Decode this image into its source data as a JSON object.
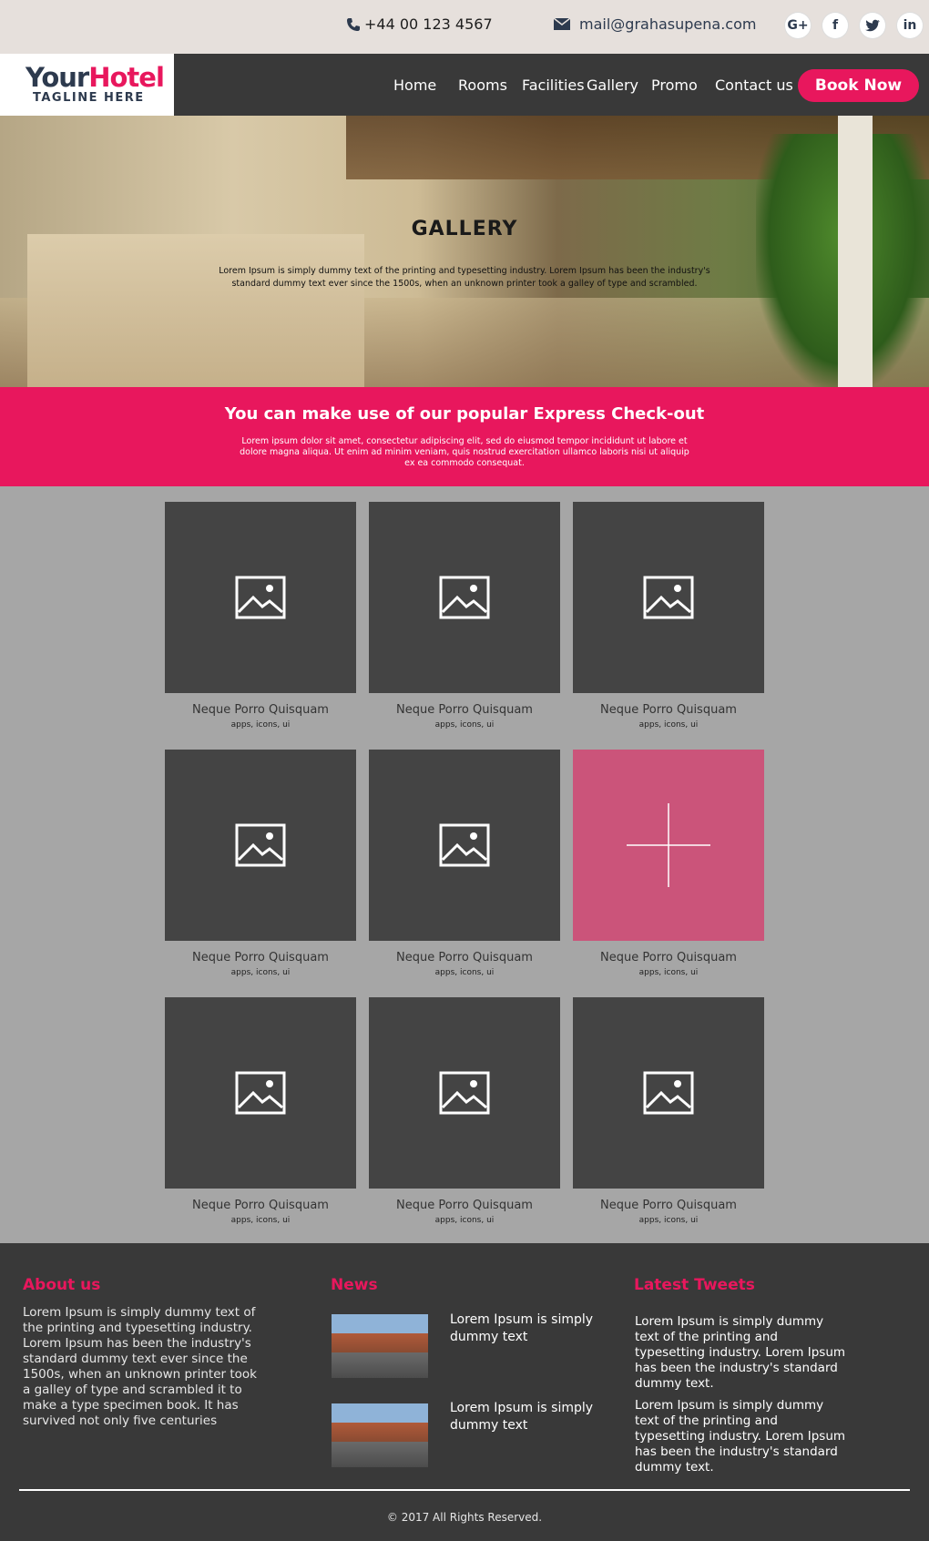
{
  "topbar": {
    "phone": "+44 00 123 4567",
    "email": "mail@grahasupena.com",
    "socials": [
      {
        "name": "google-plus",
        "glyph": "G+"
      },
      {
        "name": "facebook",
        "glyph": "f"
      },
      {
        "name": "twitter",
        "glyph": "t"
      },
      {
        "name": "linkedin",
        "glyph": "in"
      }
    ]
  },
  "logo": {
    "part1": "Your",
    "part2": "Hotel",
    "tagline": "TAGLINE HERE"
  },
  "nav": {
    "items": [
      "Home",
      "Rooms",
      "Facilities",
      "Gallery",
      "Promo",
      "Contact us"
    ],
    "book_label": "Book Now"
  },
  "hero": {
    "title": "GALLERY",
    "subtitle": "Lorem Ipsum is simply dummy text of the printing and typesetting industry. Lorem Ipsum has been the industry's standard dummy text ever since the 1500s, when an unknown printer took a galley of type and scrambled."
  },
  "band": {
    "title": "You can make use of our popular Express Check-out",
    "text": "Lorem ipsum dolor sit amet, consectetur adipiscing elit, sed do eiusmod tempor incididunt ut labore et dolore magna aliqua. Ut enim ad minim veniam, quis nostrud exercitation ullamco laboris nisi ut aliquip ex ea commodo consequat."
  },
  "gallery": {
    "items": [
      {
        "title": "Neque Porro Quisquam",
        "tags": "apps, icons, ui"
      },
      {
        "title": "Neque Porro Quisquam",
        "tags": "apps, icons, ui"
      },
      {
        "title": "Neque Porro Quisquam",
        "tags": "apps, icons, ui"
      },
      {
        "title": "Neque Porro Quisquam",
        "tags": "apps, icons, ui"
      },
      {
        "title": "Neque Porro Quisquam",
        "tags": "apps, icons, ui"
      },
      {
        "title": "Neque Porro Quisquam",
        "tags": "apps, icons, ui"
      },
      {
        "title": "Neque Porro Quisquam",
        "tags": "apps, icons, ui"
      },
      {
        "title": "Neque Porro Quisquam",
        "tags": "apps, icons, ui"
      },
      {
        "title": "Neque Porro Quisquam",
        "tags": "apps, icons, ui"
      }
    ]
  },
  "footer": {
    "about_title": "About us",
    "about_text": "Lorem Ipsum is simply dummy text of the printing and typesetting industry. Lorem Ipsum has been the industry's standard dummy text ever since the 1500s, when an unknown printer took a galley of type and scrambled it to make a type specimen book. It has survived not only five centuries",
    "news_title": "News",
    "news_items": [
      {
        "title": "Lorem Ipsum is simply dummy text"
      },
      {
        "title": "Lorem Ipsum is simply dummy text"
      }
    ],
    "tweets_title": "Latest Tweets",
    "tweets": [
      "Lorem Ipsum is simply dummy text of the printing and typesetting industry. Lorem Ipsum has been the industry's standard dummy text.",
      "Lorem Ipsum is simply dummy text of the printing and typesetting industry. Lorem Ipsum has been the industry's standard dummy text."
    ],
    "copyright": "© 2017 All Rights Reserved."
  },
  "colors": {
    "accent": "#e8175d",
    "dark": "#393939",
    "tile": "#444444",
    "tile_highlight": "#cb547a",
    "page_bg": "#a6a6a6"
  }
}
